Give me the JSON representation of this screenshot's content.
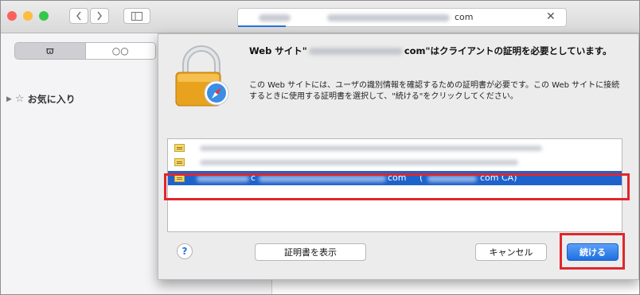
{
  "toolbar": {
    "traffic_colors": [
      "#fc605b",
      "#fdbc40",
      "#34c84a"
    ],
    "back_icon": "chevron-left-icon",
    "forward_icon": "chevron-right-icon",
    "sidebar_icon": "sidebar-toggle-icon",
    "address_text": "com",
    "close_glyph": "✕"
  },
  "sidebar": {
    "tab_bookmarks_glyph": "ϖ",
    "tab_reading_glyph": "○○",
    "favorites_label": "お気に入り"
  },
  "dialog": {
    "title_prefix": "Web サイト\"",
    "title_suffix": "com\"はクライアントの証明を必要としています。",
    "body": "この Web サイトには、ユーザの識別情報を確認するための証明書が必要です。この Web サイトに接続するときに使用する証明書を選択して、\"続ける\"をクリックしてください。",
    "selected_cert": {
      "part_a": "c",
      "part_b": "com",
      "part_c": "(",
      "part_d": "com CA)"
    },
    "buttons": {
      "help": "?",
      "show_cert": "証明書を表示",
      "cancel": "キャンセル",
      "continue": "続ける"
    }
  },
  "colors": {
    "selection": "#1e63cc",
    "highlight_box": "#e0262c",
    "primary_button": "#1f6fe0"
  }
}
